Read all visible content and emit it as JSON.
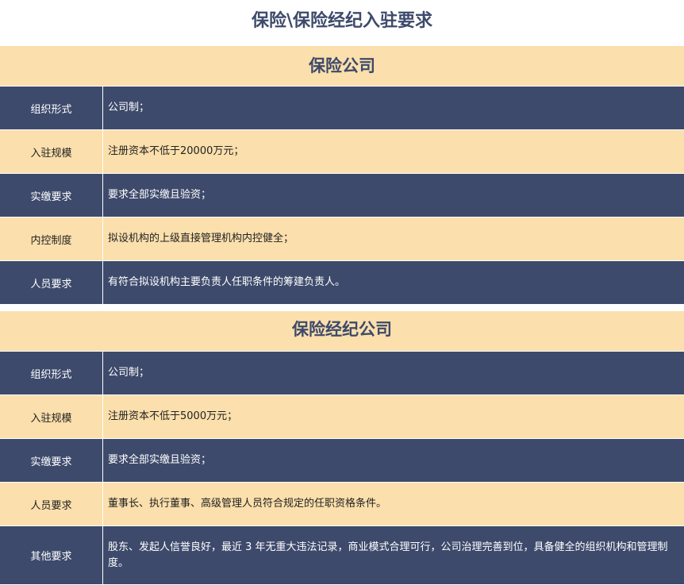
{
  "title": "保险\\保险经纪入驻要求",
  "sections": [
    {
      "header": "保险公司",
      "rows": [
        {
          "label": "组织形式",
          "value": "公司制；"
        },
        {
          "label": "入驻规模",
          "value": "注册资本不低于20000万元；"
        },
        {
          "label": "实缴要求",
          "value": "要求全部实缴且验资；"
        },
        {
          "label": "内控制度",
          "value": "拟设机构的上级直接管理机构内控健全；"
        },
        {
          "label": "人员要求",
          "value": "有符合拟设机构主要负责人任职条件的筹建负责人。"
        }
      ]
    },
    {
      "header": "保险经纪公司",
      "rows": [
        {
          "label": "组织形式",
          "value": "公司制；"
        },
        {
          "label": "入驻规模",
          "value": "注册资本不低于5000万元；"
        },
        {
          "label": "实缴要求",
          "value": "要求全部实缴且验资；"
        },
        {
          "label": "人员要求",
          "value": "董事长、执行董事、高级管理人员符合规定的任职资格条件。"
        },
        {
          "label": "其他要求",
          "value": "股东、发起人信誉良好，最近 3 年无重大违法记录，商业模式合理可行，公司治理完善到位，具备健全的组织机构和管理制度。"
        }
      ]
    }
  ],
  "colors": {
    "dark_row": "#3d4a6b",
    "light_row": "#fbdfac",
    "title_text": "#3d4a6b"
  }
}
